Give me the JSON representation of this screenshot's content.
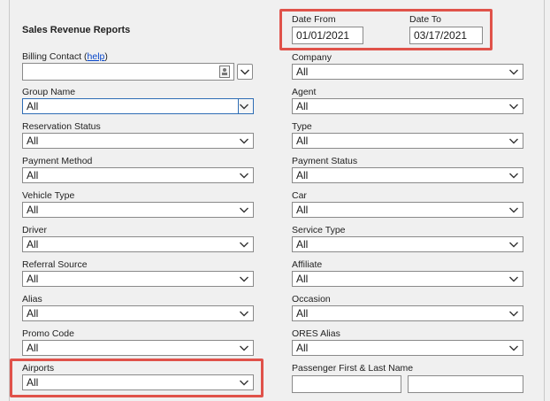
{
  "page": {
    "title": "Sales Revenue Reports"
  },
  "dates": {
    "from_label": "Date From",
    "from_value": "01/01/2021",
    "to_label": "Date To",
    "to_value": "03/17/2021"
  },
  "billing": {
    "label": "Billing Contact (",
    "help": "help",
    "label_end": ")",
    "value": ""
  },
  "left_fields": [
    {
      "label": "Group Name",
      "value": "All"
    },
    {
      "label": "Reservation Status",
      "value": "All"
    },
    {
      "label": "Payment Method",
      "value": "All"
    },
    {
      "label": "Vehicle Type",
      "value": "All"
    },
    {
      "label": "Driver",
      "value": "All"
    },
    {
      "label": "Referral Source",
      "value": "All"
    },
    {
      "label": "Alias",
      "value": "All"
    },
    {
      "label": "Promo Code",
      "value": "All"
    },
    {
      "label": "Airports",
      "value": "All"
    }
  ],
  "right_fields": [
    {
      "label": "Company",
      "value": "All"
    },
    {
      "label": "Agent",
      "value": "All"
    },
    {
      "label": "Type",
      "value": "All"
    },
    {
      "label": "Payment Status",
      "value": "All"
    },
    {
      "label": "Car",
      "value": "All"
    },
    {
      "label": "Service Type",
      "value": "All"
    },
    {
      "label": "Affiliate",
      "value": "All"
    },
    {
      "label": "Occasion",
      "value": "All"
    },
    {
      "label": "ORES Alias",
      "value": "All"
    }
  ],
  "passenger": {
    "label": "Passenger First & Last Name",
    "first_value": "",
    "last_value": ""
  },
  "colors": {
    "highlight": "#e0524a",
    "link": "#0645c9",
    "focus": "#2e6db5"
  }
}
